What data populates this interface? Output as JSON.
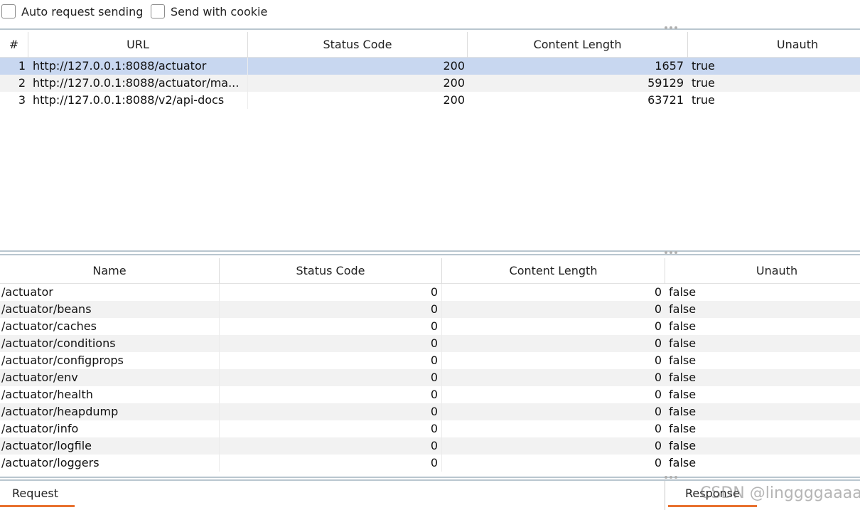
{
  "toolbar": {
    "auto_request_label": "Auto request sending",
    "auto_request_checked": false,
    "send_cookie_label": "Send with cookie",
    "send_cookie_checked": false
  },
  "top_table": {
    "columns": [
      "#",
      "URL",
      "Status Code",
      "Content Length",
      "Unauth"
    ],
    "rows": [
      {
        "num": "1",
        "url": "http://127.0.0.1:8088/actuator",
        "status": "200",
        "length": "1657",
        "unauth": "true",
        "selected": true
      },
      {
        "num": "2",
        "url": "http://127.0.0.1:8088/actuator/ma...",
        "status": "200",
        "length": "59129",
        "unauth": "true",
        "selected": false
      },
      {
        "num": "3",
        "url": "http://127.0.0.1:8088/v2/api-docs",
        "status": "200",
        "length": "63721",
        "unauth": "true",
        "selected": false
      }
    ]
  },
  "bottom_table": {
    "columns": [
      "Name",
      "Status Code",
      "Content Length",
      "Unauth"
    ],
    "rows": [
      {
        "name": "/actuator",
        "status": "0",
        "length": "0",
        "unauth": "false"
      },
      {
        "name": "/actuator/beans",
        "status": "0",
        "length": "0",
        "unauth": "false"
      },
      {
        "name": "/actuator/caches",
        "status": "0",
        "length": "0",
        "unauth": "false"
      },
      {
        "name": "/actuator/conditions",
        "status": "0",
        "length": "0",
        "unauth": "false"
      },
      {
        "name": "/actuator/configprops",
        "status": "0",
        "length": "0",
        "unauth": "false"
      },
      {
        "name": "/actuator/env",
        "status": "0",
        "length": "0",
        "unauth": "false"
      },
      {
        "name": "/actuator/health",
        "status": "0",
        "length": "0",
        "unauth": "false"
      },
      {
        "name": "/actuator/heapdump",
        "status": "0",
        "length": "0",
        "unauth": "false"
      },
      {
        "name": "/actuator/info",
        "status": "0",
        "length": "0",
        "unauth": "false"
      },
      {
        "name": "/actuator/logfile",
        "status": "0",
        "length": "0",
        "unauth": "false"
      },
      {
        "name": "/actuator/loggers",
        "status": "0",
        "length": "0",
        "unauth": "false"
      }
    ]
  },
  "tabs": {
    "request_label": "Request",
    "response_label": "Response"
  },
  "watermark": "CSDN @linggggaaaa",
  "colors": {
    "selected_row": "#c8d7f0",
    "alt_row": "#f2f2f2",
    "tab_underline": "#e8712f"
  }
}
